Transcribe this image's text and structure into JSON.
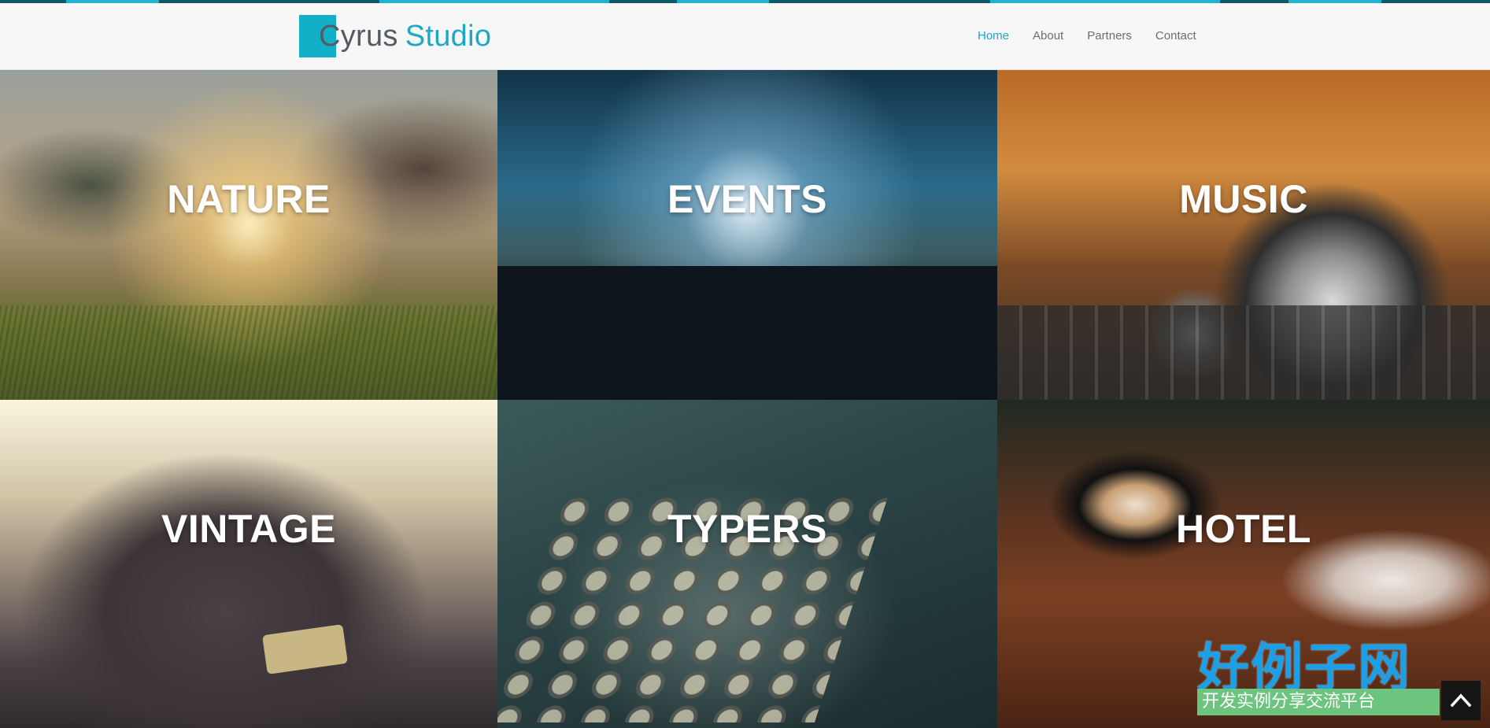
{
  "header": {
    "logo": {
      "word1": "Cyrus",
      "word2": "Studio"
    },
    "nav": [
      {
        "label": "Home",
        "active": true
      },
      {
        "label": "About",
        "active": false
      },
      {
        "label": "Partners",
        "active": false
      },
      {
        "label": "Contact",
        "active": false
      }
    ]
  },
  "gallery": {
    "tiles": [
      {
        "label": "NATURE"
      },
      {
        "label": "EVENTS"
      },
      {
        "label": "MUSIC"
      },
      {
        "label": "VINTAGE"
      },
      {
        "label": "TYPERS"
      },
      {
        "label": "HOTEL"
      }
    ]
  },
  "overlay": {
    "badge_title": "好例子网",
    "badge_subtitle": "开发实例分享交流平台",
    "back_to_top_icon": "chevron-up-icon"
  },
  "colors": {
    "accent": "#1ba9c4",
    "logo_box": "#12b0c8",
    "nav_text": "#6e6e6e",
    "header_bg": "#f7f7f7"
  }
}
